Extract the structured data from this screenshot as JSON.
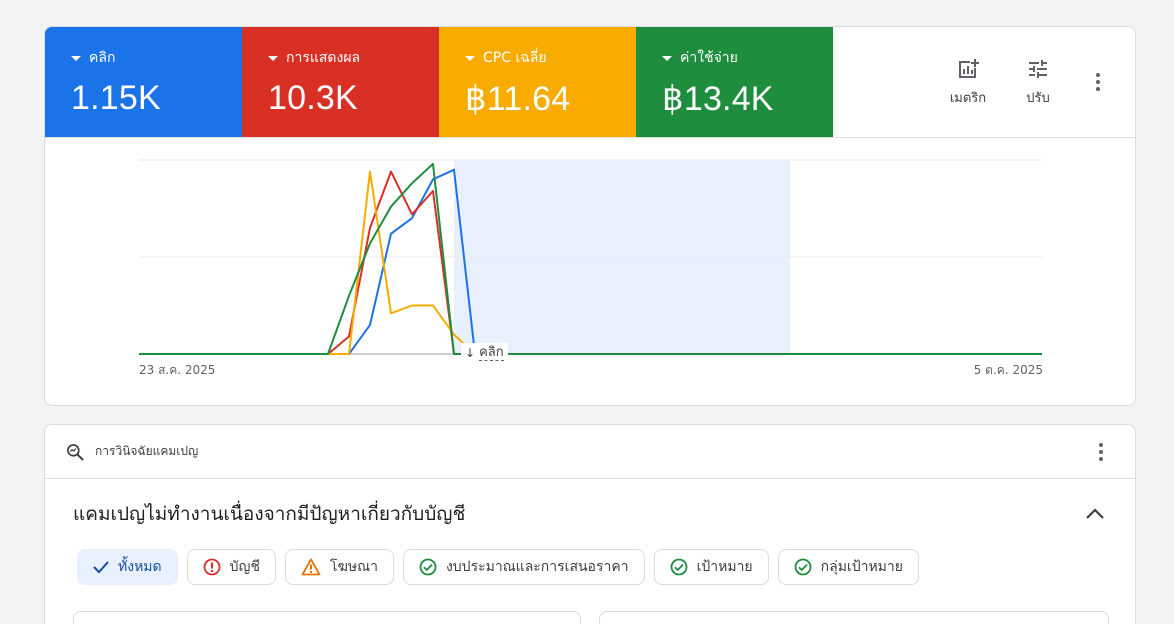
{
  "performance": {
    "tiles": [
      {
        "name": "คลิก",
        "value": "1.15K",
        "color": "#1a73e8"
      },
      {
        "name": "การแสดงผล",
        "value": "10.3K",
        "color": "#d93025"
      },
      {
        "name": "CPC เฉลี่ย",
        "value": "฿11.64",
        "color": "#f9ab00"
      },
      {
        "name": "ค่าใช้จ่าย",
        "value": "฿13.4K",
        "color": "#1e8e3e"
      }
    ],
    "tools": {
      "metrics_label": "เมตริก",
      "adjust_label": "ปรับ"
    },
    "chart": {
      "start_date": "23 ส.ค. 2025",
      "end_date": "5 ต.ค. 2025",
      "marker_label": "คลิก"
    }
  },
  "chart_data": {
    "type": "line",
    "x": [
      "23 ส.ค. 2025",
      "",
      "",
      "",
      "",
      "",
      "",
      "",
      "",
      "",
      "",
      "",
      "",
      "",
      "",
      "",
      "",
      "",
      "",
      "",
      "",
      "",
      "",
      "",
      "",
      "",
      "",
      "",
      "",
      "",
      "",
      "",
      "",
      "",
      "",
      "",
      "",
      "",
      "",
      "",
      "",
      "",
      "",
      "5 ต.ค. 2025"
    ],
    "series": [
      {
        "color": "#1a73e8",
        "values": [
          0,
          0,
          0,
          0,
          0,
          0,
          0,
          0,
          0,
          0,
          0,
          0.15,
          0.62,
          0.7,
          0.9,
          0.95,
          0,
          0,
          0,
          0,
          0,
          0,
          0,
          0,
          0,
          0,
          0,
          0,
          0,
          0,
          0,
          0,
          0,
          0,
          0,
          0,
          0,
          0,
          0,
          0,
          0,
          0,
          0,
          0
        ]
      },
      {
        "color": "#d93025",
        "values": [
          0,
          0,
          0,
          0,
          0,
          0,
          0,
          0,
          0,
          0,
          0.09,
          0.65,
          0.94,
          0.72,
          0.84,
          0,
          0,
          0,
          0,
          0,
          0,
          0,
          0,
          0,
          0,
          0,
          0,
          0,
          0,
          0,
          0,
          0,
          0,
          0,
          0,
          0,
          0,
          0,
          0,
          0,
          0,
          0,
          0,
          0
        ]
      },
      {
        "color": "#f9ab00",
        "values": [
          0,
          0,
          0,
          0,
          0,
          0,
          0,
          0,
          0,
          0,
          0,
          0.94,
          0.21,
          0.25,
          0.25,
          0.1,
          0,
          0,
          0,
          0,
          0,
          0,
          0,
          0,
          0,
          0,
          0,
          0,
          0,
          0,
          0,
          0,
          0,
          0,
          0,
          0,
          0,
          0,
          0,
          0,
          0,
          0,
          0,
          0
        ]
      },
      {
        "color": "#1e8e3e",
        "values": [
          0,
          0,
          0,
          0,
          0,
          0,
          0,
          0,
          0,
          0,
          0.3,
          0.57,
          0.76,
          0.88,
          0.98,
          0,
          0,
          0,
          0,
          0,
          0,
          0,
          0,
          0,
          0,
          0,
          0,
          0,
          0,
          0,
          0,
          0,
          0,
          0,
          0,
          0,
          0,
          0,
          0,
          0,
          0,
          0,
          0,
          0
        ]
      }
    ],
    "ylim": [
      0,
      1
    ],
    "grid": true,
    "highlight_range": [
      15,
      31
    ],
    "highlight_color": "#e8f0fe"
  },
  "diagnosis": {
    "header_title": "การวินิจฉัยแคมเปญ",
    "issue_title": "แคมเปญไม่ทำงานเนื่องจากมีปัญหาเกี่ยวกับบัญชี",
    "chips": [
      {
        "label": "ทั้งหมด",
        "icon": "check-icon",
        "selected": true
      },
      {
        "label": "บัญชี",
        "icon": "error-icon",
        "selected": false
      },
      {
        "label": "โฆษณา",
        "icon": "warning-icon",
        "selected": false
      },
      {
        "label": "งบประมาณและการเสนอราคา",
        "icon": "check-circle-icon",
        "selected": false
      },
      {
        "label": "เป้าหมาย",
        "icon": "check-circle-icon",
        "selected": false
      },
      {
        "label": "กลุ่มเป้าหมาย",
        "icon": "check-circle-icon",
        "selected": false
      }
    ]
  }
}
